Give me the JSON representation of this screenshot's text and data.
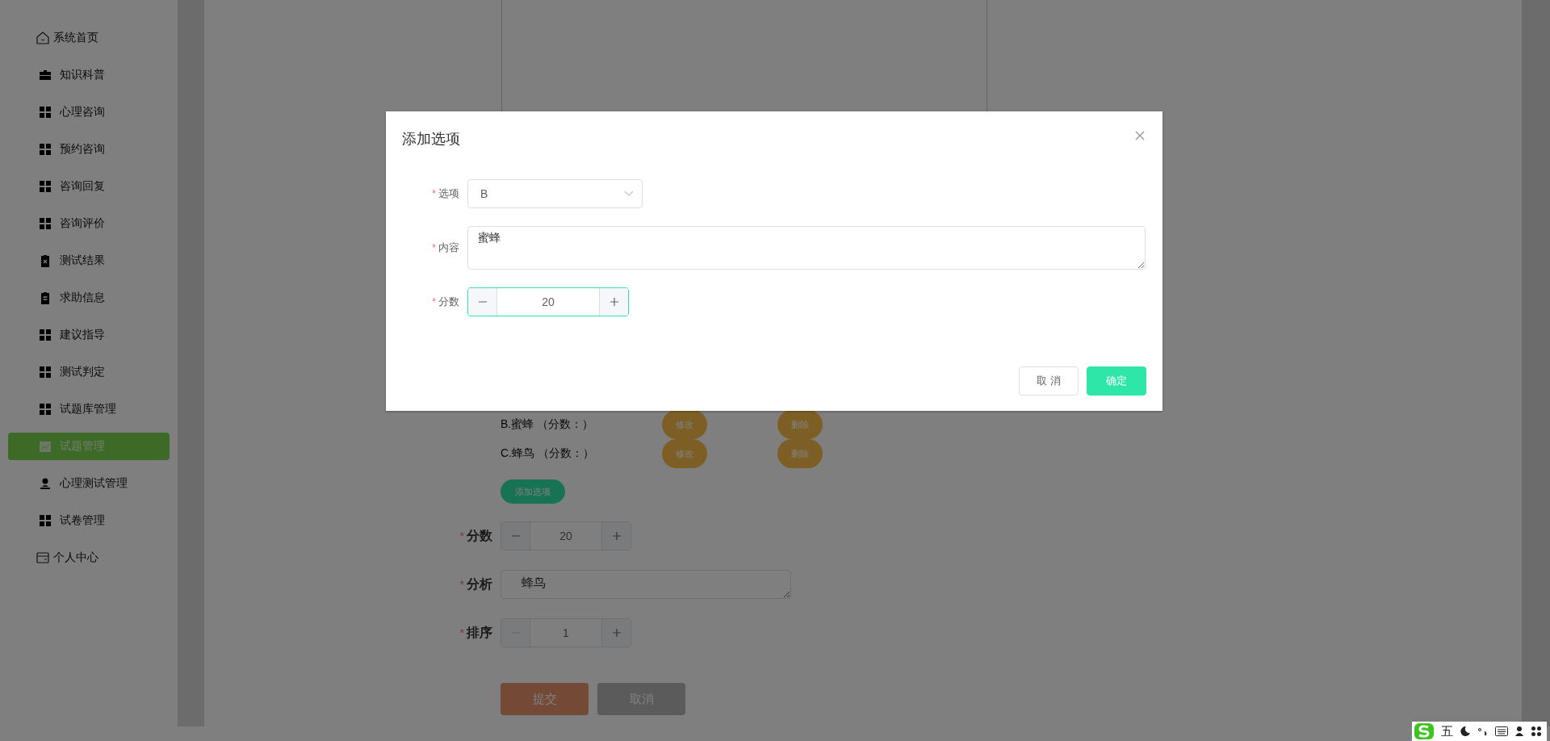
{
  "sidebar": {
    "items": [
      {
        "label": "系统首页",
        "kind": "top",
        "selected": false
      },
      {
        "label": "知识科普",
        "kind": "sub",
        "selected": false
      },
      {
        "label": "心理咨询",
        "kind": "sub",
        "selected": false
      },
      {
        "label": "预约咨询",
        "kind": "sub",
        "selected": false
      },
      {
        "label": "咨询回复",
        "kind": "sub",
        "selected": false
      },
      {
        "label": "咨询评价",
        "kind": "sub",
        "selected": false
      },
      {
        "label": "测试结果",
        "kind": "sub",
        "selected": false
      },
      {
        "label": "求助信息",
        "kind": "sub",
        "selected": false
      },
      {
        "label": "建议指导",
        "kind": "sub",
        "selected": false
      },
      {
        "label": "测试判定",
        "kind": "sub",
        "selected": false
      },
      {
        "label": "试题库管理",
        "kind": "sub",
        "selected": false
      },
      {
        "label": "试题管理",
        "kind": "sub",
        "selected": true
      },
      {
        "label": "心理测试管理",
        "kind": "sub",
        "selected": false
      },
      {
        "label": "试卷管理",
        "kind": "sub",
        "selected": false
      },
      {
        "label": "个人中心",
        "kind": "top",
        "selected": false
      }
    ]
  },
  "form": {
    "options": [
      {
        "text": "B.蜜蜂 （分数：）",
        "edit": "修改",
        "delete": "删除"
      },
      {
        "text": "C.蜂鸟 （分数：）",
        "edit": "修改",
        "delete": "删除"
      }
    ],
    "add_option": "添加选项",
    "fields": [
      {
        "kind": "number",
        "mark": "*",
        "label": "分数",
        "value": "20",
        "decrease_disabled": false
      },
      {
        "kind": "textarea",
        "mark": "*",
        "label": "分析",
        "value": "蜂鸟"
      },
      {
        "kind": "number",
        "mark": "*",
        "label": "排序",
        "value": "1",
        "decrease_disabled": true
      }
    ],
    "buttons": [
      {
        "label": "提交",
        "kind": "primary"
      },
      {
        "label": "取消",
        "kind": "secondary"
      }
    ]
  },
  "dialog": {
    "title": "添加选项",
    "fields": [
      {
        "kind": "select",
        "mark": "*",
        "label": "选项",
        "value": "B"
      },
      {
        "kind": "textarea",
        "mark": "*",
        "label": "内容",
        "value": "蜜蜂"
      },
      {
        "kind": "number",
        "mark": "*",
        "label": "分数",
        "value": "20",
        "focused": true
      }
    ],
    "buttons": [
      {
        "label": "取 消",
        "kind": "secondary"
      },
      {
        "label": "确定",
        "kind": "primary"
      }
    ]
  },
  "ime_bar": {
    "mode": "五"
  }
}
